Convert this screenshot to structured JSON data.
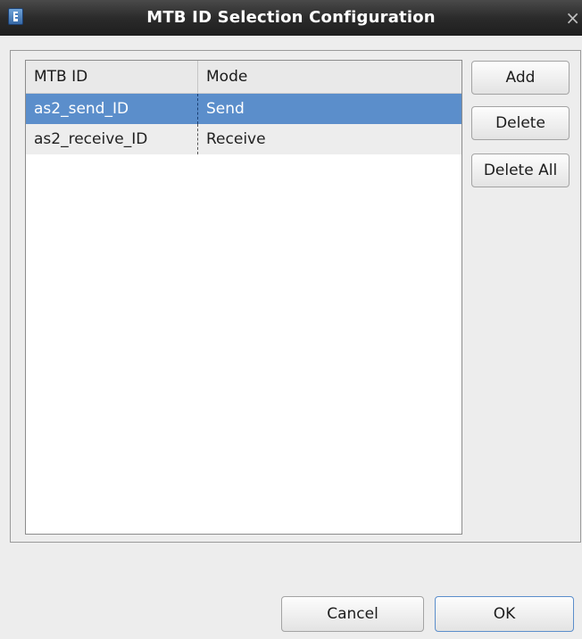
{
  "window": {
    "title": "MTB ID Selection Configuration",
    "close_glyph": "×",
    "icon": "app-icon"
  },
  "table": {
    "columns": [
      "MTB ID",
      "Mode"
    ],
    "rows": [
      {
        "mtb_id": "as2_send_ID",
        "mode": "Send",
        "selected": true
      },
      {
        "mtb_id": "as2_receive_ID",
        "mode": "Receive",
        "selected": false
      }
    ]
  },
  "side_buttons": {
    "add": "Add",
    "delete": "Delete",
    "delete_all": "Delete All"
  },
  "footer": {
    "cancel": "Cancel",
    "ok": "OK"
  },
  "colors": {
    "titlebar": "#2b2b2b",
    "selection": "#5b8ecb",
    "background": "#ededed"
  }
}
